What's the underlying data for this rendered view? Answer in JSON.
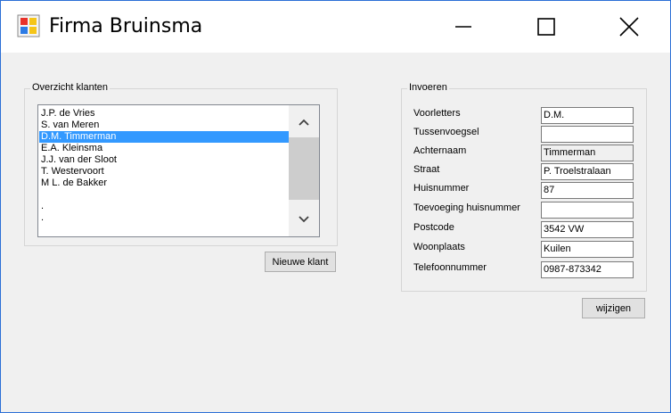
{
  "window": {
    "title": "Firma Bruinsma",
    "app_icon": "winforms-app-icon",
    "controls": [
      "minimize-icon",
      "maximize-icon",
      "close-icon"
    ]
  },
  "customers_group": {
    "legend": "Overzicht klanten",
    "items": [
      "J.P.  de Vries",
      "S.  van Meren",
      "D.M.  Timmerman",
      "E.A.  Kleinsma",
      "J.J. van der Sloot",
      "T.  Westervoort",
      "M L. de Bakker",
      "",
      ".",
      "."
    ],
    "selected_index": 2,
    "new_customer_button": "Nieuwe klant"
  },
  "input_group": {
    "legend": "Invoeren",
    "fields": [
      {
        "label": "Voorletters",
        "value": "D.M."
      },
      {
        "label": "Tussenvoegsel",
        "value": ""
      },
      {
        "label": "Achternaam",
        "value": "Timmerman"
      },
      {
        "label": "Straat",
        "value": "P. Troelstralaan"
      },
      {
        "label": "Huisnummer",
        "value": "87"
      },
      {
        "label": "Toevoeging huisnummer",
        "value": ""
      },
      {
        "label": "Postcode",
        "value": "3542 VW"
      },
      {
        "label": "Woonplaats",
        "value": "Kuilen"
      },
      {
        "label": "Telefoonnummer",
        "value": "0987-873342"
      }
    ],
    "edit_button": "wijzigen"
  },
  "colors": {
    "selection": "#3399ff",
    "window_border": "#2b6fd6",
    "background": "#f0f0f0"
  }
}
